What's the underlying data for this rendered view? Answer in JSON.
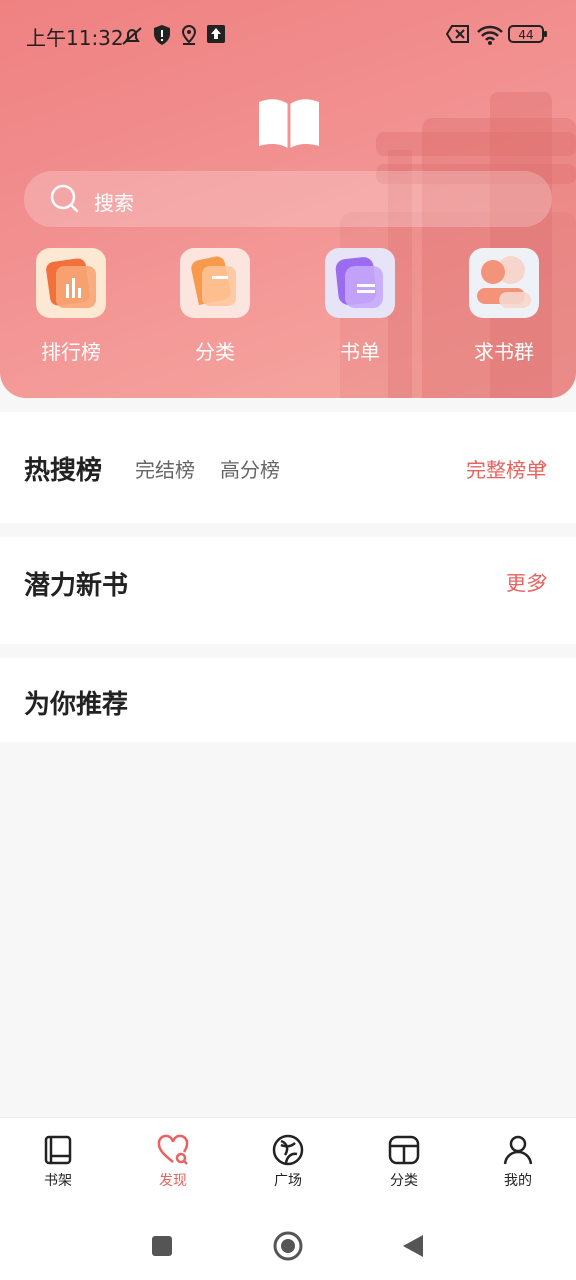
{
  "status_bar": {
    "time": "上午11:32",
    "battery": "44"
  },
  "search": {
    "placeholder": "搜索"
  },
  "quick_actions": [
    {
      "label": "排行榜",
      "icon": "ranking-icon"
    },
    {
      "label": "分类",
      "icon": "category-icon"
    },
    {
      "label": "书单",
      "icon": "booklist-icon"
    },
    {
      "label": "求书群",
      "icon": "book-request-group-icon"
    }
  ],
  "hot_section": {
    "title": "热搜榜",
    "tabs": [
      "完结榜",
      "高分榜"
    ],
    "more": "完整榜单"
  },
  "potential_section": {
    "title": "潜力新书",
    "more": "更多"
  },
  "recommend_section": {
    "title": "为你推荐"
  },
  "tab_bar": {
    "items": [
      {
        "label": "书架",
        "icon": "bookshelf-icon"
      },
      {
        "label": "发现",
        "icon": "discover-heart-icon",
        "active": true
      },
      {
        "label": "广场",
        "icon": "square-icon"
      },
      {
        "label": "分类",
        "icon": "category-tab-icon"
      },
      {
        "label": "我的",
        "icon": "profile-icon"
      }
    ]
  },
  "colors": {
    "accent": "#e8625f",
    "header_start": "#ef8181",
    "header_end": "#f6a9a2"
  }
}
